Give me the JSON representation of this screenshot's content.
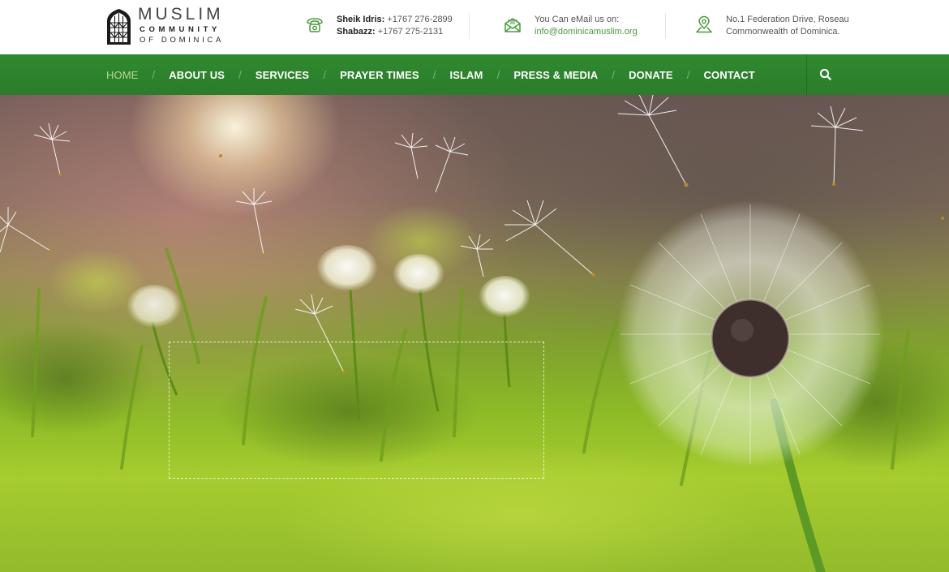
{
  "logo": {
    "word": "MUSLIM",
    "line2": "COMMUNITY",
    "line3": "OF DOMINICA"
  },
  "contacts": {
    "phone": {
      "name1": "Sheik Idris:",
      "number1": "+1767 276-2899",
      "name2": "Shabazz:",
      "number2": "+1767 275-2131",
      "icon": "phone-icon"
    },
    "email": {
      "label": "You Can eMail us on:",
      "address": "info@dominicamuslim.org",
      "icon": "envelope-icon"
    },
    "address": {
      "line1": "No.1 Federation Drive, Roseau",
      "line2": "Commonwealth of Dominica.",
      "icon": "map-pin-icon"
    }
  },
  "nav": {
    "items": [
      {
        "label": "HOME",
        "active": true
      },
      {
        "label": "ABOUT US",
        "active": false
      },
      {
        "label": "SERVICES",
        "active": false
      },
      {
        "label": "PRAYER TIMES",
        "active": false
      },
      {
        "label": "ISLAM",
        "active": false
      },
      {
        "label": "PRESS & MEDIA",
        "active": false
      },
      {
        "label": "DONATE",
        "active": false
      },
      {
        "label": "CONTACT",
        "active": false
      }
    ],
    "separator": "/",
    "search_icon": "search-icon"
  },
  "colors": {
    "brand_green": "#2e7d32",
    "active_nav": "#b9d98a",
    "link_green": "#4a9a3a"
  },
  "hero": {
    "image": "dandelion-meadow-photo"
  }
}
